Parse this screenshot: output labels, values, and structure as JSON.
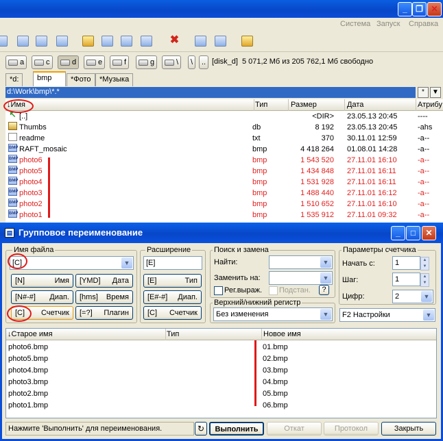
{
  "menu": {
    "items": [
      "Система",
      "Запуск",
      "Справка"
    ]
  },
  "drives": [
    {
      "label": "a"
    },
    {
      "label": "c"
    },
    {
      "label": "d"
    },
    {
      "label": "e"
    },
    {
      "label": "f"
    },
    {
      "label": "g"
    },
    {
      "label": "\\"
    }
  ],
  "drivebar": {
    "back": "\\",
    "up": "..",
    "disk": "[disk_d]",
    "info": "5 071,2 Мб из 205 762,1 Мб свободно"
  },
  "tabs": [
    "*d:",
    "bmp",
    "*Фото",
    "*Музыка"
  ],
  "path": {
    "value": "d:\\Work\\bmp\\*.*",
    "star": "*",
    "arrow": "▼"
  },
  "list": {
    "headers": {
      "name": "↓Имя",
      "type": "Тип",
      "size": "Размер",
      "date": "Дата",
      "attr": "Атрибу"
    },
    "rows": [
      {
        "name": "[..]",
        "type": "",
        "size": "<DIR>",
        "date": "23.05.13 20:45",
        "attr": "----",
        "icon": "up-arrow-icon",
        "red": false
      },
      {
        "name": "Thumbs",
        "type": "db",
        "size": "8 192",
        "date": "23.05.13 20:45",
        "attr": "-ahs",
        "icon": "db-file-icon",
        "red": false
      },
      {
        "name": "readme",
        "type": "txt",
        "size": "370",
        "date": "30.11.01 12:59",
        "attr": "-a--",
        "icon": "text-file-icon",
        "red": false
      },
      {
        "name": "RAFT_mosaic",
        "type": "bmp",
        "size": "4 418 264",
        "date": "01.08.01 14:28",
        "attr": "-a--",
        "icon": "bmp-file-icon",
        "red": false
      },
      {
        "name": "photo6",
        "type": "bmp",
        "size": "1 543 520",
        "date": "27.11.01 16:10",
        "attr": "-a--",
        "icon": "bmp-file-icon",
        "red": true
      },
      {
        "name": "photo5",
        "type": "bmp",
        "size": "1 434 848",
        "date": "27.11.01 16:11",
        "attr": "-a--",
        "icon": "bmp-file-icon",
        "red": true
      },
      {
        "name": "photo4",
        "type": "bmp",
        "size": "1 531 928",
        "date": "27.11.01 16:11",
        "attr": "-a--",
        "icon": "bmp-file-icon",
        "red": true
      },
      {
        "name": "photo3",
        "type": "bmp",
        "size": "1 488 440",
        "date": "27.11.01 16:12",
        "attr": "-a--",
        "icon": "bmp-file-icon",
        "red": true
      },
      {
        "name": "photo2",
        "type": "bmp",
        "size": "1 510 652",
        "date": "27.11.01 16:10",
        "attr": "-a--",
        "icon": "bmp-file-icon",
        "red": true
      },
      {
        "name": "photo1",
        "type": "bmp",
        "size": "1 535 912",
        "date": "27.11.01 09:32",
        "attr": "-a--",
        "icon": "bmp-file-icon",
        "red": true
      }
    ]
  },
  "dialog": {
    "title": "Групповое переименование",
    "filename": {
      "label": "Имя файла",
      "value": "[C]",
      "buttons": [
        {
          "left": "[N]",
          "right": "Имя"
        },
        {
          "left": "[YMD]",
          "right": "Дата"
        },
        {
          "left": "[N#-#]",
          "right": "Диап."
        },
        {
          "left": "[hms]",
          "right": "Время"
        },
        {
          "left": "[C]",
          "right": "Счетчик"
        },
        {
          "left": "[=?]",
          "right": "Плагин"
        }
      ]
    },
    "extension": {
      "label": "Расширение",
      "value": "[E]",
      "buttons": [
        {
          "left": "[E]",
          "right": "Тип"
        },
        {
          "left": "[E#-#]",
          "right": "Диап."
        },
        {
          "left": "[C]",
          "right": "Счетчик"
        }
      ]
    },
    "search": {
      "label": "Поиск и замена",
      "find": "Найти:",
      "replace": "Заменить на:",
      "regex": "Рег.выраж.",
      "subst": "Подстан.",
      "help": "?"
    },
    "case": {
      "label": "Верхний/нижний регистр",
      "value": "Без изменения"
    },
    "counter": {
      "label": "Параметры счетчика",
      "start_label": "Начать с:",
      "start": "1",
      "step_label": "Шаг:",
      "step": "1",
      "digits_label": "Цифр:",
      "digits": "2",
      "settings": "F2 Настройки"
    },
    "table": {
      "headers": {
        "old": "↓Старое имя",
        "type": "Тип",
        "new": "Новое имя"
      },
      "rows": [
        {
          "old": "photo6.bmp",
          "new": "01.bmp"
        },
        {
          "old": "photo5.bmp",
          "new": "02.bmp"
        },
        {
          "old": "photo4.bmp",
          "new": "03.bmp"
        },
        {
          "old": "photo3.bmp",
          "new": "04.bmp"
        },
        {
          "old": "photo2.bmp",
          "new": "05.bmp"
        },
        {
          "old": "photo1.bmp",
          "new": "06.bmp"
        }
      ]
    },
    "status": "Нажмите 'Выполнить' для переименования.",
    "buttons": {
      "run": "Выполнить",
      "undo": "Откат",
      "log": "Протокол",
      "close": "Закрыть"
    }
  }
}
